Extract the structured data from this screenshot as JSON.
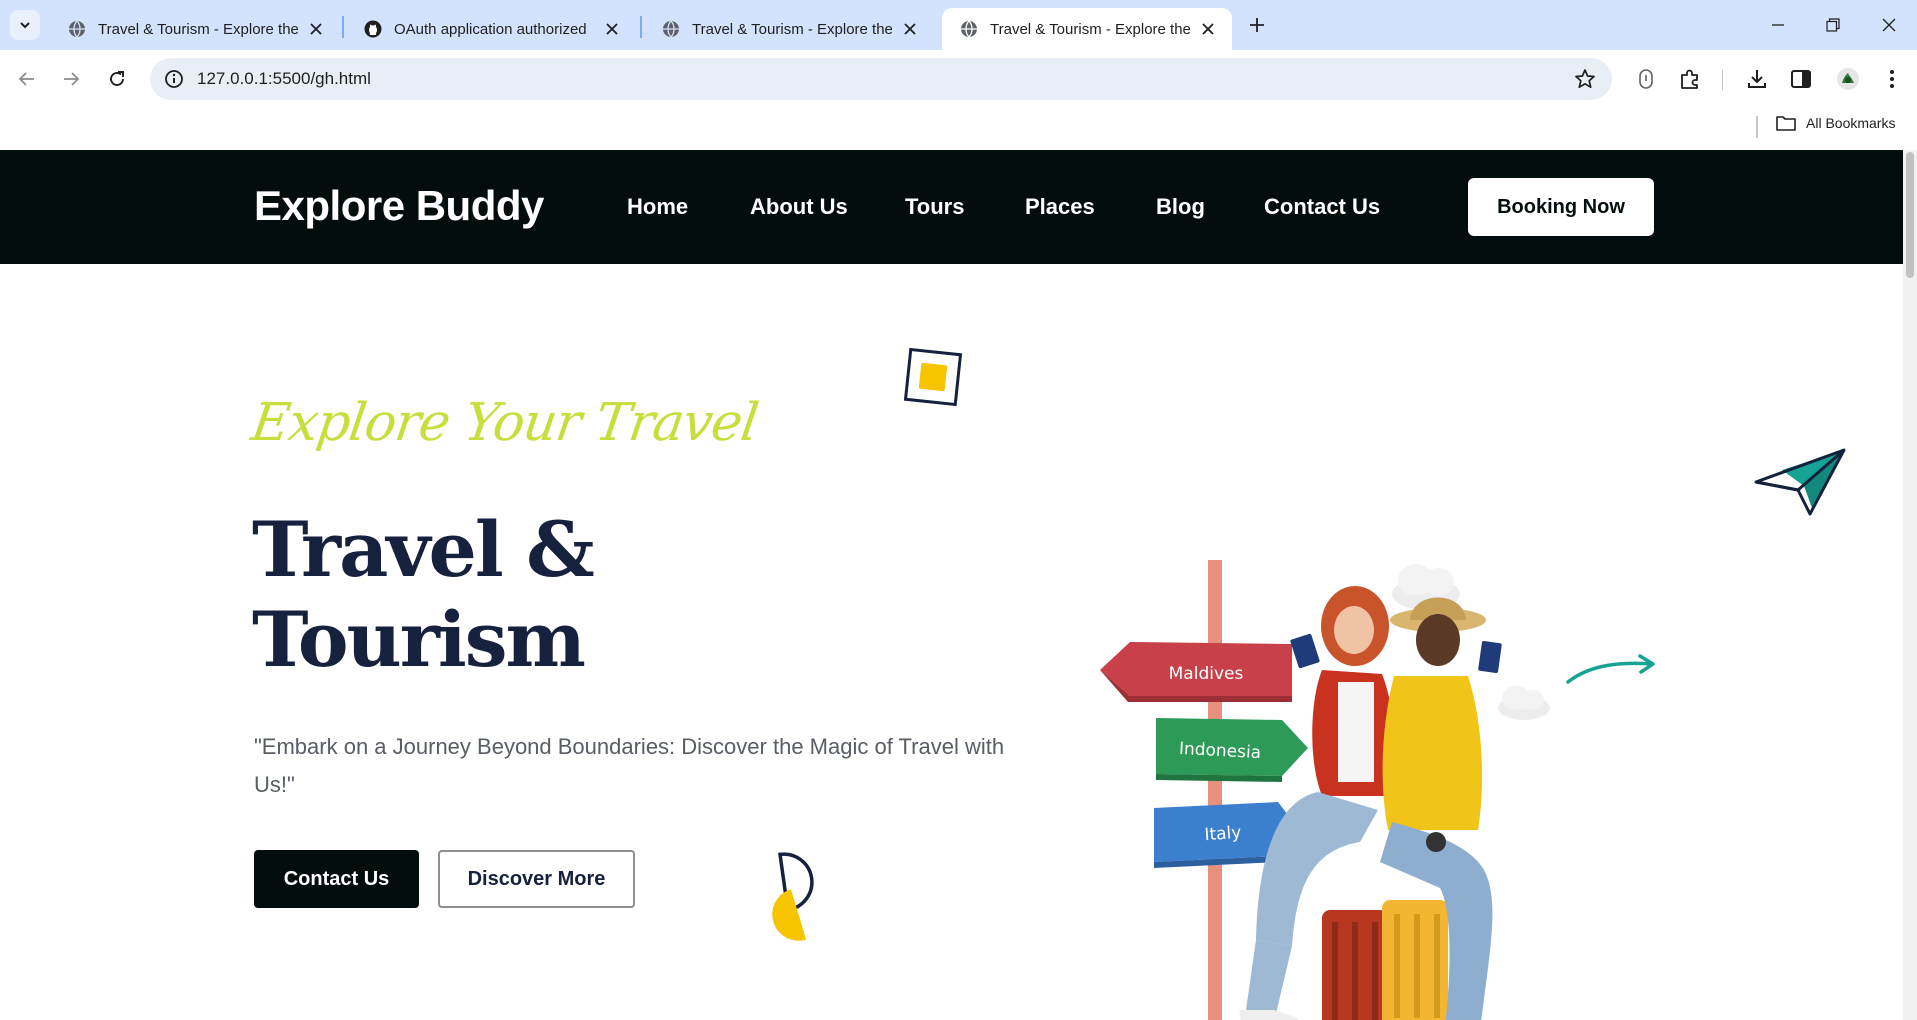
{
  "browser": {
    "tabs": [
      {
        "title": "Travel & Tourism - Explore the D",
        "favicon": "globe-icon"
      },
      {
        "title": "OAuth application authorized",
        "favicon": "github-icon"
      },
      {
        "title": "Travel & Tourism - Explore the D",
        "favicon": "globe-icon"
      },
      {
        "title": "Travel & Tourism - Explore the D",
        "favicon": "globe-icon",
        "active": true
      }
    ],
    "url": "127.0.0.1:5500/gh.html",
    "bookmarks_label": "All Bookmarks"
  },
  "site": {
    "logo": "Explore Buddy",
    "nav": [
      "Home",
      "About Us",
      "Tours",
      "Places",
      "Blog",
      "Contact Us"
    ],
    "booking_button": "Booking Now"
  },
  "hero": {
    "tagline": "Explore Your Travel",
    "title_line1": "Travel &",
    "title_line2": "Tourism",
    "subtitle": "\"Embark on a Journey Beyond Boundaries: Discover the Magic of Travel with Us!\"",
    "primary_button": "Contact Us",
    "secondary_button": "Discover More",
    "signpost": [
      "Maldives",
      "Indonesia",
      "Italy"
    ]
  },
  "colors": {
    "header_bg": "#040d0e",
    "accent_lime": "#c8de3c",
    "title_navy": "#16213e",
    "accent_yellow": "#f7c400",
    "accent_teal": "#16a394"
  }
}
